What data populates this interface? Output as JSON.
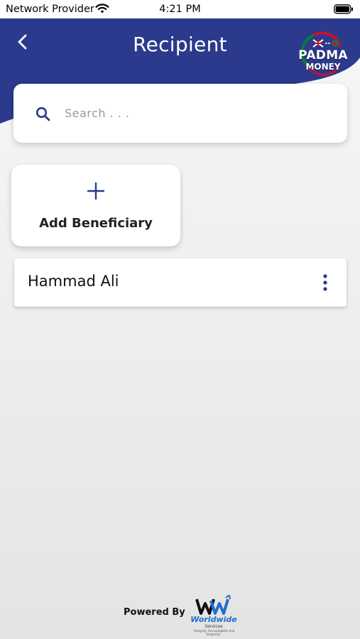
{
  "status_bar": {
    "carrier": "Network Provider",
    "time": "4:21 PM",
    "wifi_icon": "wifi-icon",
    "battery_icon": "battery-icon"
  },
  "header": {
    "title": "Recipient",
    "back_icon": "chevron-left-icon",
    "background_color": "#2b3a8c",
    "logo": {
      "name": "PADMA",
      "sub": "MONEY",
      "colors": [
        "#c8102e",
        "#0a7a3f",
        "#ffffff"
      ]
    }
  },
  "search": {
    "placeholder": "Search . . .",
    "value": "",
    "icon": "search-icon",
    "icon_color": "#2b3a8c"
  },
  "add_beneficiary": {
    "label": "Add Beneficiary",
    "icon": "plus-icon"
  },
  "recipients": [
    {
      "name": "Hammad Ali",
      "menu_icon": "more-vertical-icon"
    }
  ],
  "footer": {
    "powered_by": "Powered By",
    "company_mark": "WW",
    "company_name": "Worldwide",
    "company_services": "Services",
    "company_tagline": "\"Integrity, Accountability and Simplicity\"",
    "accent_color": "#1f6fd1"
  }
}
